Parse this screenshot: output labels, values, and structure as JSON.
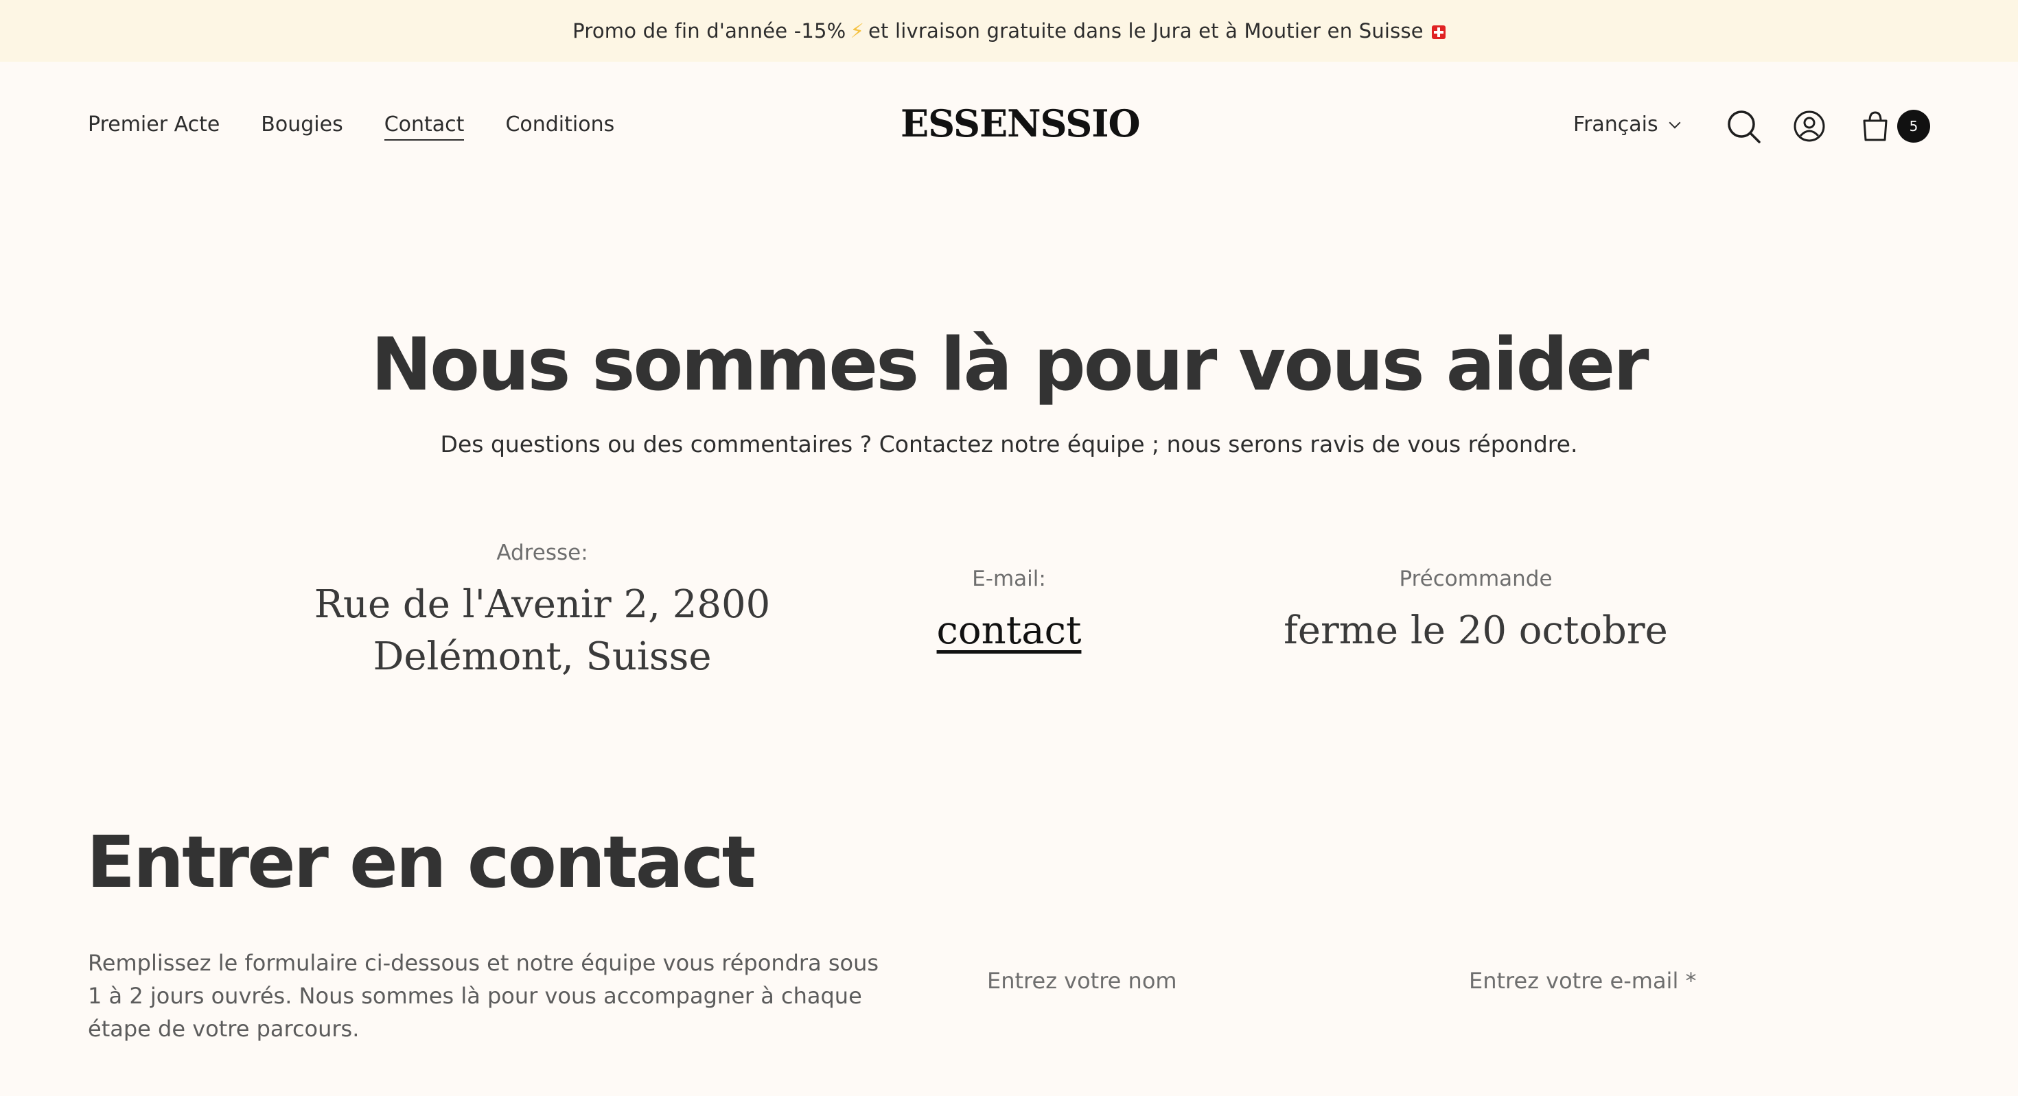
{
  "announcement": {
    "text_before": "Promo de fin d'année -15%",
    "bolt": "⚡",
    "text_after": "et livraison gratuite dans le Jura et à Moutier en Suisse"
  },
  "nav": {
    "items": [
      {
        "label": "Premier Acte"
      },
      {
        "label": "Bougies"
      },
      {
        "label": "Contact",
        "active": true
      },
      {
        "label": "Conditions"
      }
    ]
  },
  "brand": {
    "logo": "ESSENSSIO"
  },
  "header_right": {
    "language": "Français",
    "cart_count": "5",
    "icons": [
      "search-icon",
      "account-icon",
      "cart-icon"
    ]
  },
  "hero": {
    "title": "Nous sommes là pour vous aider",
    "subtitle": "Des questions ou des commentaires ? Contactez notre équipe ; nous serons ravis de vous répondre."
  },
  "info": {
    "address_label": "Adresse:",
    "address_line1": "Rue de l'Avenir 2, 2800",
    "address_line2": "Delémont, Suisse",
    "email_label": "E-mail:",
    "email_link": "contact",
    "preorder_label": "Précommande",
    "preorder_value": "ferme le 20 octobre"
  },
  "contact": {
    "title": "Entrer en contact",
    "description": "Remplissez le formulaire ci-dessous et notre équipe vous répondra sous 1 à 2 jours ouvrés. Nous sommes là pour vous accompagner à chaque étape de votre parcours.",
    "name_placeholder": "Entrez votre nom",
    "email_placeholder": "Entrez votre e-mail *"
  },
  "colors": {
    "page_bg": "#fefaf6",
    "announcement_bg": "#fdf6e4",
    "text": "#2d2d2d",
    "badge_bg": "#111111"
  }
}
